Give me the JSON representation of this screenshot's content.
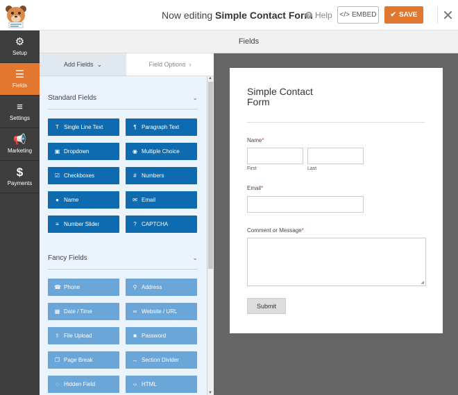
{
  "topbar": {
    "editing_prefix": "Now editing",
    "form_name": "Simple Contact Form",
    "help_label": "Help",
    "embed_label": "EMBED",
    "save_label": "SAVE",
    "accent_color": "#e27730"
  },
  "leftnav": {
    "items": [
      {
        "label": "Setup",
        "icon": "gear-icon"
      },
      {
        "label": "Fields",
        "icon": "list-icon",
        "active": true
      },
      {
        "label": "Settings",
        "icon": "sliders-icon"
      },
      {
        "label": "Marketing",
        "icon": "megaphone-icon"
      },
      {
        "label": "Payments",
        "icon": "dollar-icon"
      }
    ]
  },
  "header": {
    "title": "Fields"
  },
  "panel": {
    "tabs": [
      {
        "label": "Add Fields",
        "active": true
      },
      {
        "label": "Field Options"
      }
    ],
    "standard": {
      "title": "Standard Fields",
      "buttons": [
        {
          "label": "Single Line Text",
          "icon": "text-icon"
        },
        {
          "label": "Paragraph Text",
          "icon": "paragraph-icon"
        },
        {
          "label": "Dropdown",
          "icon": "dropdown-icon"
        },
        {
          "label": "Multiple Choice",
          "icon": "radio-icon"
        },
        {
          "label": "Checkboxes",
          "icon": "checkbox-icon"
        },
        {
          "label": "Numbers",
          "icon": "hash-icon"
        },
        {
          "label": "Name",
          "icon": "user-icon"
        },
        {
          "label": "Email",
          "icon": "envelope-icon"
        },
        {
          "label": "Number Slider",
          "icon": "slider-icon"
        },
        {
          "label": "CAPTCHA",
          "icon": "question-icon"
        }
      ]
    },
    "fancy": {
      "title": "Fancy Fields",
      "buttons": [
        {
          "label": "Phone",
          "icon": "phone-icon"
        },
        {
          "label": "Address",
          "icon": "map-pin-icon"
        },
        {
          "label": "Date / Time",
          "icon": "calendar-icon"
        },
        {
          "label": "Website / URL",
          "icon": "link-icon"
        },
        {
          "label": "File Upload",
          "icon": "upload-icon"
        },
        {
          "label": "Password",
          "icon": "lock-icon"
        },
        {
          "label": "Page Break",
          "icon": "copy-icon"
        },
        {
          "label": "Section Divider",
          "icon": "arrows-h-icon"
        },
        {
          "label": "Hidden Field",
          "icon": "eye-slash-icon"
        },
        {
          "label": "HTML",
          "icon": "code-icon"
        }
      ]
    }
  },
  "form": {
    "title": "Simple Contact Form",
    "name_label": "Name",
    "first_label": "First",
    "last_label": "Last",
    "email_label": "Email",
    "comment_label": "Comment or Message",
    "required_mark": "*",
    "submit_label": "Submit"
  }
}
